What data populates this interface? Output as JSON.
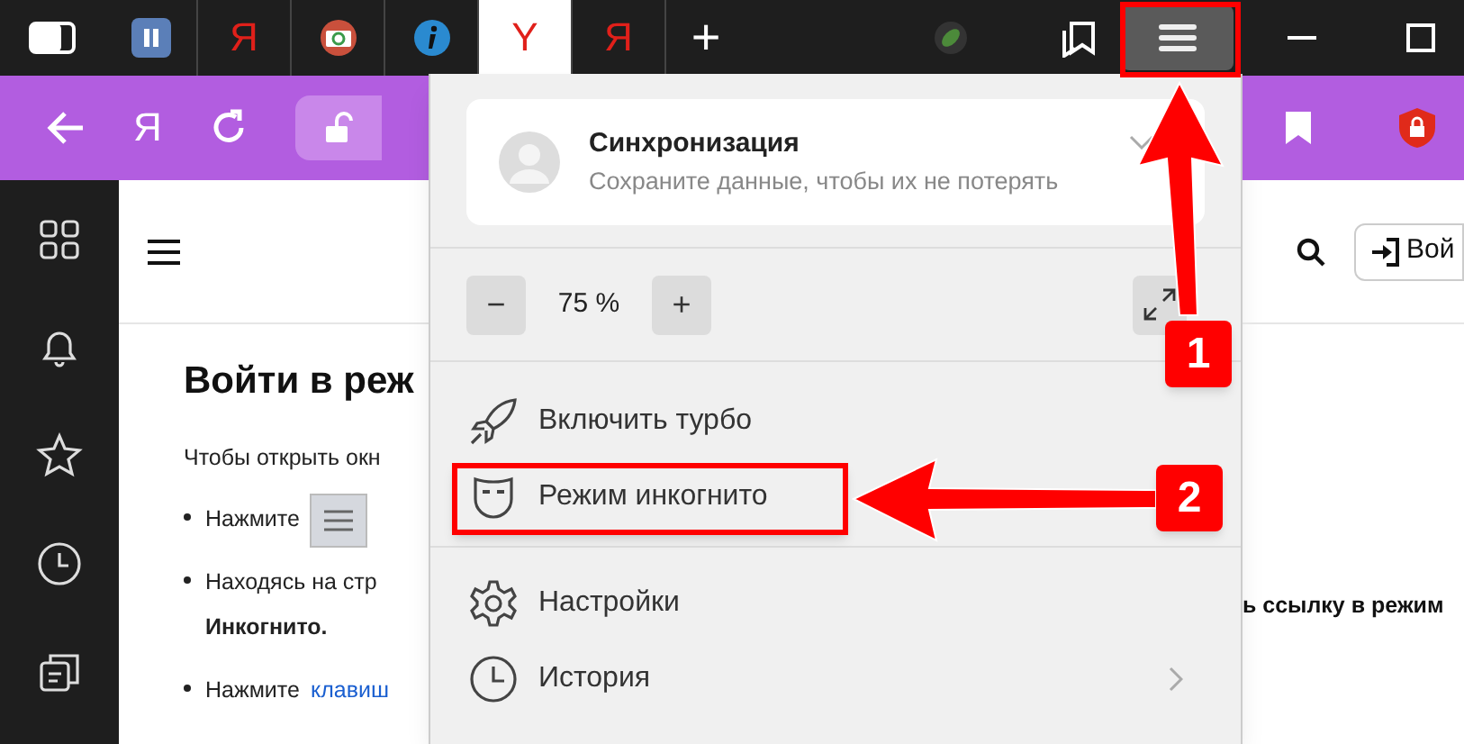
{
  "tab_bar": {
    "tabs": [
      {
        "kind": "pause",
        "selected": false
      },
      {
        "kind": "letter",
        "label": "Я",
        "selected": false
      },
      {
        "kind": "camera",
        "selected": false
      },
      {
        "kind": "info",
        "selected": false
      },
      {
        "kind": "letter",
        "label": "Y",
        "selected": true
      },
      {
        "kind": "letter",
        "label": "Я",
        "selected": false
      }
    ],
    "new_tab": "+"
  },
  "toolbar": {
    "home_letter": "Я"
  },
  "page": {
    "heading": "Войти в реж",
    "intro": "Чтобы открыть окн",
    "bullets": [
      {
        "parts": [
          "Нажмите"
        ],
        "kind": "menu-button"
      },
      {
        "parts": [
          "Находясь на стр",
          "**Инкогнито.**"
        ],
        "kind": "text"
      },
      {
        "parts": [
          "Нажмите"
        ],
        "link": "клавиш",
        "kind": "link"
      }
    ],
    "right_text": "ь ссылку в режим",
    "login_button": "Вой"
  },
  "menu": {
    "sync": {
      "title": "Синхронизация",
      "subtitle": "Сохраните данные, чтобы их не потерять"
    },
    "zoom": {
      "minus": "−",
      "value": "75 %",
      "plus": "+"
    },
    "items": [
      {
        "kind": "turbo",
        "label": "Включить турбо",
        "submenu": false
      },
      {
        "kind": "incognito",
        "label": "Режим инкогнито",
        "submenu": false
      },
      {
        "kind": "settings",
        "label": "Настройки",
        "submenu": false
      },
      {
        "kind": "history",
        "label": "История",
        "submenu": true
      }
    ]
  },
  "annotations": {
    "badges": [
      "1",
      "2"
    ]
  }
}
